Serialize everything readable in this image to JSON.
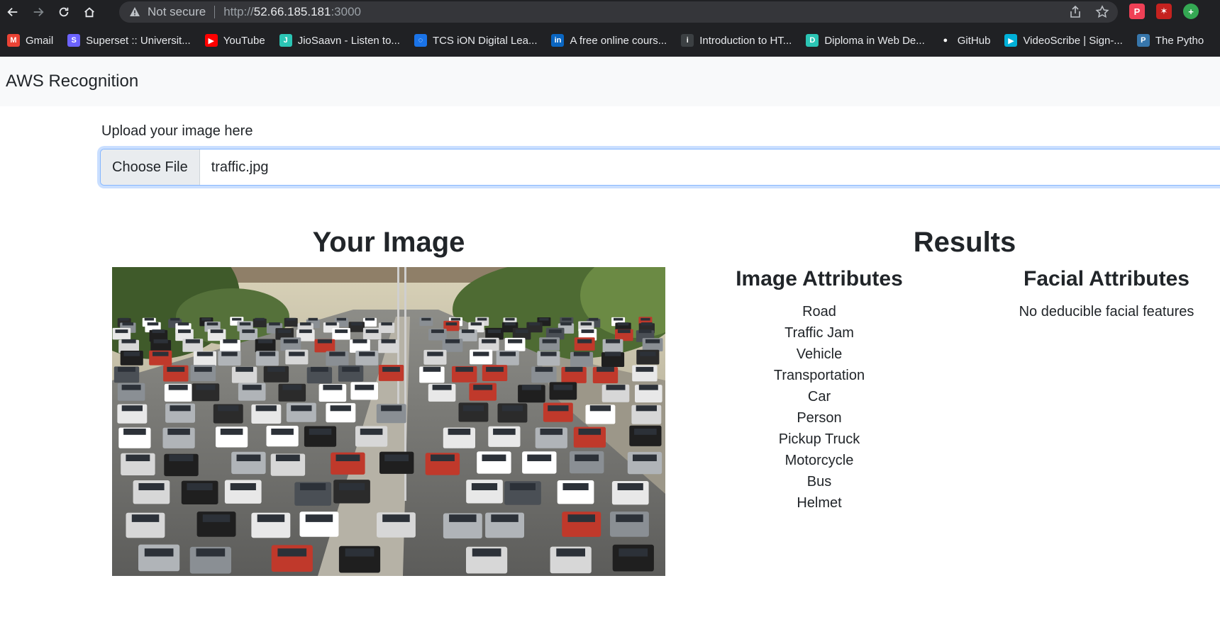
{
  "browser": {
    "security_label": "Not secure",
    "url_scheme": "http://",
    "url_host": "52.66.185.181",
    "url_port": ":3000",
    "bookmarks": [
      {
        "label": "Gmail",
        "icon": "gmail-icon",
        "color": "#ea4335",
        "glyph": "M"
      },
      {
        "label": "Superset :: Universit...",
        "icon": "superset-icon",
        "color": "#6c63ff",
        "glyph": "S"
      },
      {
        "label": "YouTube",
        "icon": "youtube-icon",
        "color": "#ff0000",
        "glyph": "▶"
      },
      {
        "label": "JioSaavn - Listen to...",
        "icon": "jiosaavn-icon",
        "color": "#2bc5b4",
        "glyph": "J"
      },
      {
        "label": "TCS iON Digital Lea...",
        "icon": "tcs-ion-icon",
        "color": "#1a73e8",
        "glyph": "◌"
      },
      {
        "label": "A free online cours...",
        "icon": "linkedin-icon",
        "color": "#0a66c2",
        "glyph": "in"
      },
      {
        "label": "Introduction to HT...",
        "icon": "intro-html-icon",
        "color": "#3c4043",
        "glyph": "i"
      },
      {
        "label": "Diploma in Web De...",
        "icon": "diploma-icon",
        "color": "#2bc5b4",
        "glyph": "D"
      },
      {
        "label": "GitHub",
        "icon": "github-icon",
        "color": "#ffffff",
        "glyph": "●"
      },
      {
        "label": "VideoScribe | Sign-...",
        "icon": "videoscribe-icon",
        "color": "#00b0d8",
        "glyph": "▶"
      },
      {
        "label": "The Pytho",
        "icon": "python-icon",
        "color": "#3776ab",
        "glyph": "P"
      }
    ]
  },
  "navbar": {
    "brand": "AWS Recognition"
  },
  "upload": {
    "label": "Upload your image here",
    "button": "Choose File",
    "file_name": "traffic.jpg"
  },
  "image_section": {
    "title": "Your Image"
  },
  "results": {
    "title": "Results",
    "image_attributes": {
      "title": "Image Attributes",
      "items": [
        "Road",
        "Traffic Jam",
        "Vehicle",
        "Transportation",
        "Car",
        "Person",
        "Pickup Truck",
        "Motorcycle",
        "Bus",
        "Helmet"
      ]
    },
    "facial_attributes": {
      "title": "Facial Attributes",
      "message": "No deducible facial features"
    }
  }
}
